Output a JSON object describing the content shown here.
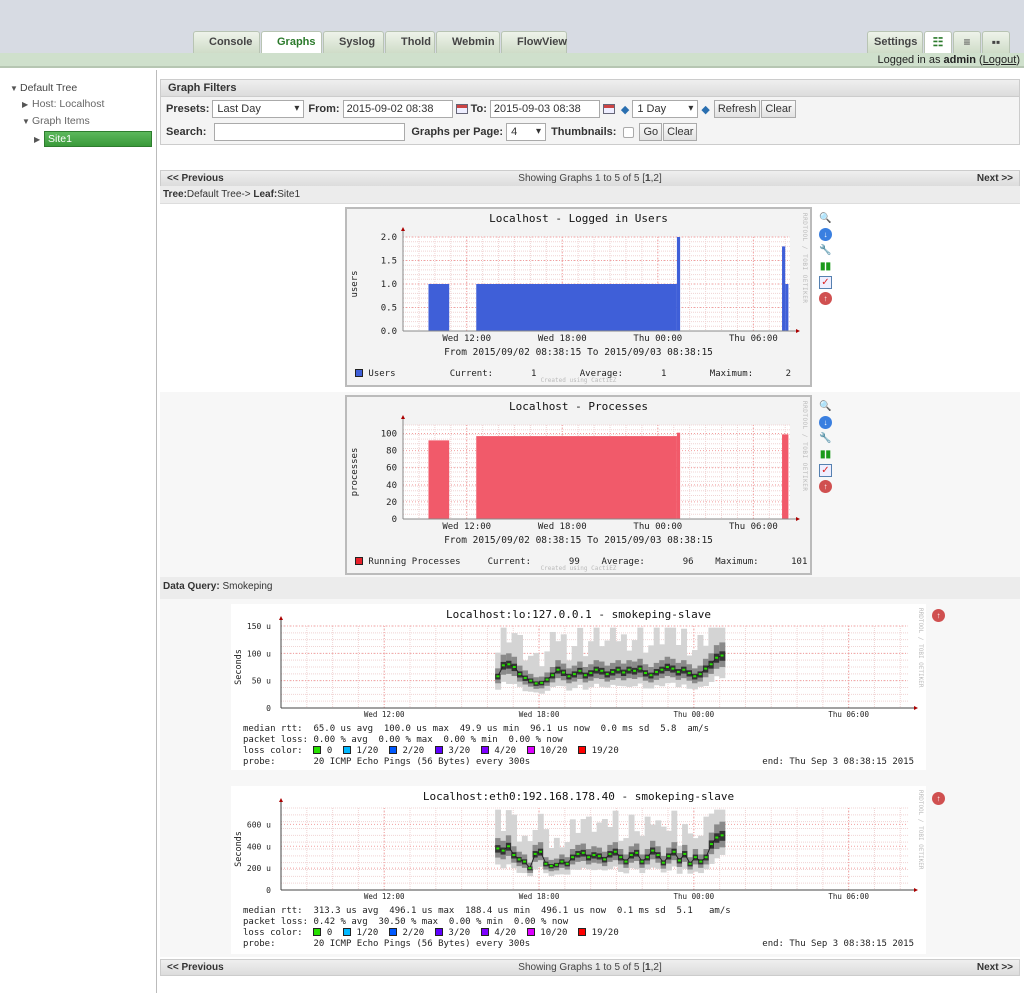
{
  "nav": {
    "tabs": [
      {
        "label": "Console",
        "active": false
      },
      {
        "label": "Graphs",
        "active": true
      },
      {
        "label": "Syslog",
        "active": false
      },
      {
        "label": "Thold",
        "active": false
      },
      {
        "label": "Webmin",
        "active": false
      },
      {
        "label": "FlowView",
        "active": false
      }
    ],
    "settings_label": "Settings",
    "view_modes": [
      "tree-view-icon",
      "list-view-icon",
      "preview-view-icon"
    ]
  },
  "status": {
    "logged_prefix": "Logged in as",
    "user": "admin",
    "logout": "Logout"
  },
  "sidebar": {
    "root": "Default Tree",
    "items": [
      {
        "label": "Host: Localhost",
        "expanded": false
      },
      {
        "label": "Graph Items",
        "expanded": true
      }
    ],
    "selected": "Site1"
  },
  "filters": {
    "title": "Graph Filters",
    "presets_label": "Presets:",
    "presets_value": "Last Day",
    "from_label": "From:",
    "from_value": "2015-09-02 08:38",
    "to_label": "To:",
    "to_value": "2015-09-03 08:38",
    "timespan_value": "1 Day",
    "refresh_label": "Refresh",
    "clear_label": "Clear",
    "search_label": "Search:",
    "search_value": "",
    "per_page_label": "Graphs per Page:",
    "per_page_value": "4",
    "thumbnails_label": "Thumbnails:",
    "thumbnails_checked": false,
    "go_label": "Go",
    "clear2_label": "Clear"
  },
  "pager": {
    "prev": "<< Previous",
    "next": "Next >>",
    "showing": "Showing Graphs 1 to 5 of 5 [",
    "page1": "1",
    "page2": "2",
    "close": "]"
  },
  "leaf": {
    "tree_label": "Tree:",
    "tree": "Default Tree",
    "arrow": "->",
    "leaf_label": "Leaf:",
    "leaf": "Site1"
  },
  "data_query": {
    "label": "Data Query:",
    "value": "Smokeping"
  },
  "chart_data": [
    {
      "type": "area",
      "title": "Localhost - Logged in Users",
      "ylabel": "users",
      "ylim": [
        0,
        2.0
      ],
      "yticks": [
        "0.0",
        "0.5",
        "1.0",
        "1.5",
        "2.0"
      ],
      "xticks": [
        "Wed 12:00",
        "Wed 18:00",
        "Thu 00:00",
        "Thu 06:00"
      ],
      "xsub": "From 2015/09/02 08:38:15 To 2015/09/03 08:38:15",
      "color": "#3f5fd8",
      "series": [
        {
          "name": "Users",
          "segments": [
            [
              9.6,
              10.9,
              1.0
            ],
            [
              12.6,
              25.2,
              1.0
            ],
            [
              25.2,
              25.4,
              2.0
            ],
            [
              31.8,
              32.0,
              1.8
            ],
            [
              32.0,
              32.2,
              1.0
            ]
          ]
        }
      ],
      "legend": {
        "name": "Users",
        "current": "1",
        "average": "1",
        "maximum": "2"
      },
      "side": "RRDTOOL / TOBI OETIKER",
      "created": "Created using CactiEZ"
    },
    {
      "type": "area",
      "title": "Localhost - Processes",
      "ylabel": "processes",
      "ylim": [
        0,
        110
      ],
      "yticks": [
        "0",
        "20",
        "40",
        "60",
        "80",
        "100"
      ],
      "xticks": [
        "Wed 12:00",
        "Wed 18:00",
        "Thu 00:00",
        "Thu 06:00"
      ],
      "xsub": "From 2015/09/02 08:38:15 To 2015/09/03 08:38:15",
      "color": "#f15a6a",
      "series": [
        {
          "name": "Running Processes",
          "segments": [
            [
              9.6,
              10.9,
              92
            ],
            [
              12.6,
              25.2,
              97
            ],
            [
              25.2,
              25.4,
              101
            ],
            [
              31.8,
              32.2,
              99
            ]
          ]
        }
      ],
      "legend": {
        "name": "Running Processes",
        "current": "99",
        "average": "96",
        "maximum": "101"
      },
      "side": "RRDTOOL / TOBI OETIKER",
      "created": "Created using CactiEZ"
    },
    {
      "type": "line",
      "title": "Localhost:lo:127.0.0.1 - smokeping-slave",
      "ylabel": "Seconds",
      "ylim": [
        0,
        150
      ],
      "yticks": [
        "0",
        "50 u",
        "100 u",
        "150 u"
      ],
      "xticks": [
        "Wed 12:00",
        "Wed 18:00",
        "Thu 00:00",
        "Thu 06:00"
      ],
      "median_seed": [
        58,
        78,
        80,
        75,
        62,
        55,
        50,
        45,
        46,
        52,
        60,
        70,
        65,
        58,
        62,
        68,
        60,
        64,
        70,
        68,
        62,
        66,
        70,
        65,
        70,
        68,
        72,
        64,
        60,
        66,
        70,
        75,
        72,
        66,
        70,
        64,
        58,
        62,
        72,
        80,
        92,
        96
      ],
      "stats": {
        "median_rtt": "median rtt:  65.0 us avg  100.0 us max  49.9 us min  96.1 us now  0.0 ms sd  5.8  am/s",
        "packet_loss": "packet loss: 0.00 % avg  0.00 % max  0.00 % min  0.00 % now",
        "loss_color_label": "loss color:",
        "probe": "probe:       20 ICMP Echo Pings (56 Bytes) every 300s"
      },
      "end": "end: Thu Sep  3 08:38:15 2015",
      "side": "RRDTOOL / TOBI OETIKER"
    },
    {
      "type": "line",
      "title": "Localhost:eth0:192.168.178.40 - smokeping-slave",
      "ylabel": "Seconds",
      "ylim": [
        0,
        750
      ],
      "yticks": [
        "0",
        "200 u",
        "400 u",
        "600 u"
      ],
      "xticks": [
        "Wed 12:00",
        "Wed 18:00",
        "Thu 00:00",
        "Thu 06:00"
      ],
      "median_seed": [
        380,
        360,
        400,
        320,
        280,
        260,
        200,
        330,
        350,
        240,
        220,
        230,
        260,
        240,
        300,
        330,
        340,
        300,
        320,
        310,
        280,
        330,
        350,
        300,
        260,
        320,
        340,
        260,
        300,
        360,
        320,
        250,
        310,
        350,
        270,
        330,
        240,
        300,
        260,
        300,
        420,
        480,
        500
      ],
      "stats": {
        "median_rtt": "median rtt:  313.3 us avg  496.1 us max  188.4 us min  496.1 us now  0.1 ms sd  5.1   am/s",
        "packet_loss": "packet loss: 0.42 % avg  30.50 % max  0.00 % min  0.00 % now",
        "loss_color_label": "loss color:",
        "probe": "probe:       20 ICMP Echo Pings (56 Bytes) every 300s"
      },
      "end": "end: Thu Sep  3 08:38:15 2015",
      "side": "RRDTOOL / TOBI OETIKER"
    }
  ],
  "loss_colors": [
    {
      "label": "0",
      "color": "#26e000"
    },
    {
      "label": "1/20",
      "color": "#00b8ff"
    },
    {
      "label": "2/20",
      "color": "#0059ff"
    },
    {
      "label": "3/20",
      "color": "#5e00ff"
    },
    {
      "label": "4/20",
      "color": "#7e00ff"
    },
    {
      "label": "10/20",
      "color": "#dd00ff"
    },
    {
      "label": "19/20",
      "color": "#ff0000"
    }
  ],
  "graph_actions": [
    "zoom-icon",
    "download-icon",
    "properties-icon",
    "realtime-icon",
    "thold-icon",
    "up-icon"
  ]
}
